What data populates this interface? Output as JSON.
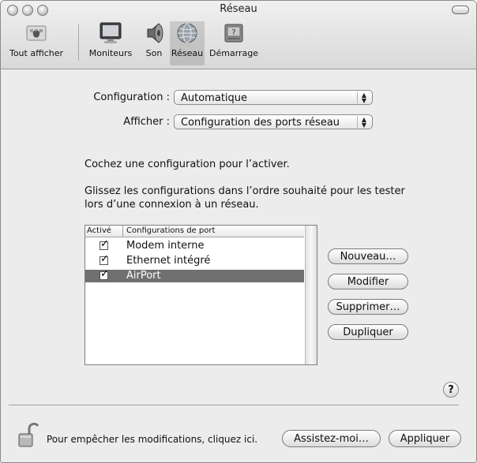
{
  "window": {
    "title": "Réseau"
  },
  "toolbar": {
    "items": [
      {
        "label": "Tout afficher",
        "icon": "show-all-icon"
      },
      {
        "label": "Moniteurs",
        "icon": "display-icon"
      },
      {
        "label": "Son",
        "icon": "speaker-icon"
      },
      {
        "label": "Réseau",
        "icon": "network-globe-icon",
        "selected": true
      },
      {
        "label": "Démarrage",
        "icon": "startup-disk-icon"
      }
    ]
  },
  "form": {
    "configuration_label": "Configuration :",
    "configuration_value": "Automatique",
    "show_label": "Afficher :",
    "show_value": "Configuration des ports réseau"
  },
  "instructions": {
    "line1": "Cochez une configuration pour l’activer.",
    "line2": "Glissez les configurations dans l’ordre souhaité pour les tester",
    "line3": "lors d’une connexion à un réseau."
  },
  "table": {
    "headers": {
      "active": "Activé",
      "config": "Configurations de port"
    },
    "rows": [
      {
        "label": "Modem interne",
        "checked": true,
        "selected": false
      },
      {
        "label": "Ethernet intégré",
        "checked": true,
        "selected": false
      },
      {
        "label": "AirPort",
        "checked": true,
        "selected": true
      }
    ]
  },
  "buttons": {
    "new": "Nouveau…",
    "modify": "Modifier",
    "delete": "Supprimer…",
    "duplicate": "Dupliquer",
    "assist": "Assistez-moi…",
    "apply": "Appliquer",
    "help": "?"
  },
  "footer": {
    "lock_text": "Pour empêcher les modifications, cliquez ici."
  },
  "colors": {
    "selection": "#707070",
    "window_bg": "#ececec"
  }
}
